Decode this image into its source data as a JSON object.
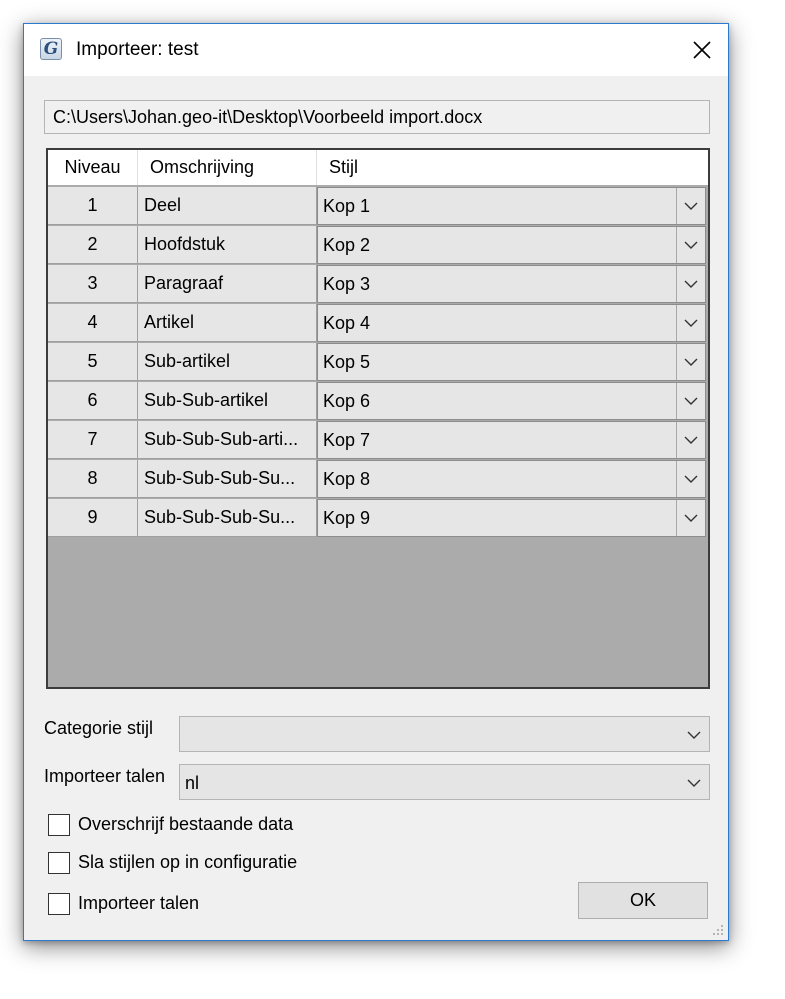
{
  "window": {
    "title": "Importeer: test",
    "app_icon_glyph": "G",
    "close_icon": "close-icon"
  },
  "file_path": "C:\\Users\\Johan.geo-it\\Desktop\\Voorbeeld import.docx",
  "grid": {
    "columns": [
      "Niveau",
      "Omschrijving",
      "Stijl"
    ],
    "rows": [
      {
        "niveau": "1",
        "omschrijving": "Deel",
        "stijl": "Kop 1"
      },
      {
        "niveau": "2",
        "omschrijving": "Hoofdstuk",
        "stijl": "Kop 2"
      },
      {
        "niveau": "3",
        "omschrijving": "Paragraaf",
        "stijl": "Kop 3"
      },
      {
        "niveau": "4",
        "omschrijving": "Artikel",
        "stijl": "Kop 4"
      },
      {
        "niveau": "5",
        "omschrijving": "Sub-artikel",
        "stijl": "Kop 5"
      },
      {
        "niveau": "6",
        "omschrijving": "Sub-Sub-artikel",
        "stijl": "Kop 6"
      },
      {
        "niveau": "7",
        "omschrijving": "Sub-Sub-Sub-arti...",
        "stijl": "Kop 7"
      },
      {
        "niveau": "8",
        "omschrijving": "Sub-Sub-Sub-Su...",
        "stijl": "Kop 8"
      },
      {
        "niveau": "9",
        "omschrijving": "Sub-Sub-Sub-Su...",
        "stijl": "Kop 9"
      }
    ]
  },
  "form": {
    "categorie_label": "Categorie stijl",
    "categorie_value": "",
    "talen_label": "Importeer talen",
    "talen_value": "nl"
  },
  "checkboxes": [
    {
      "label": "Overschrijf bestaande data",
      "checked": false
    },
    {
      "label": "Sla stijlen op in configuratie",
      "checked": false
    },
    {
      "label": "Importeer talen",
      "checked": false
    }
  ],
  "ok_label": "OK",
  "colors": {
    "window_border": "#2b79d0",
    "grid_background": "#ababab",
    "dialog_background": "#f0f0f0"
  }
}
